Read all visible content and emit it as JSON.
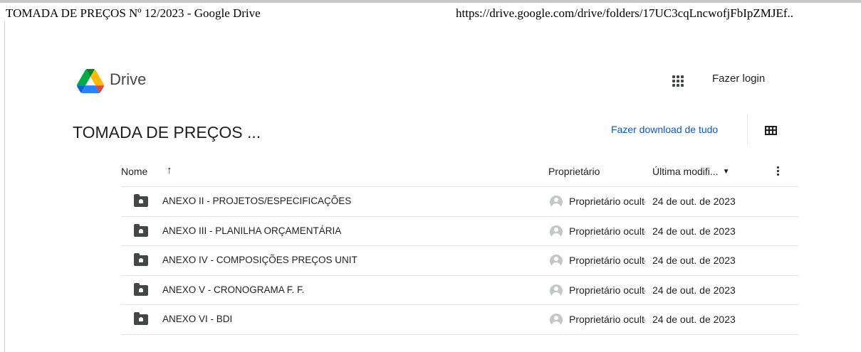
{
  "print_header": {
    "title": "TOMADA DE PREÇOS Nº 12/2023 - Google Drive",
    "url": "https://drive.google.com/drive/folders/17UC3cqLncwofjFbIpZMJEf.."
  },
  "app": {
    "name": "Drive",
    "login_label": "Fazer login",
    "apps_icon": "apps-grid-icon"
  },
  "folder": {
    "title": "TOMADA DE PREÇOS ...",
    "download_all_label": "Fazer download de tudo",
    "view_icon": "grid-view-icon"
  },
  "table": {
    "columns": {
      "name": "Nome",
      "owner": "Proprietário",
      "modified": "Última modifi..."
    },
    "sort_icon": "arrow-up-icon",
    "rows": [
      {
        "name": "ANEXO II - PROJETOS/ESPECIFICAÇÕES",
        "owner": "Proprietário oculto",
        "modified": "24 de out. de 2023"
      },
      {
        "name": "ANEXO III - PLANILHA ORÇAMENTÁRIA",
        "owner": "Proprietário oculto",
        "modified": "24 de out. de 2023"
      },
      {
        "name": "ANEXO IV - COMPOSIÇÕES PREÇOS UNIT",
        "owner": "Proprietário oculto",
        "modified": "24 de out. de 2023"
      },
      {
        "name": "ANEXO V - CRONOGRAMA F. F.",
        "owner": "Proprietário oculto",
        "modified": "24 de out. de 2023"
      },
      {
        "name": "ANEXO VI - BDI",
        "owner": "Proprietário oculto",
        "modified": "24 de out. de 2023"
      }
    ]
  },
  "colors": {
    "link": "#0b57d0",
    "text": "#1f1f1f",
    "icon": "#444746",
    "divider": "#e3e3e3"
  }
}
